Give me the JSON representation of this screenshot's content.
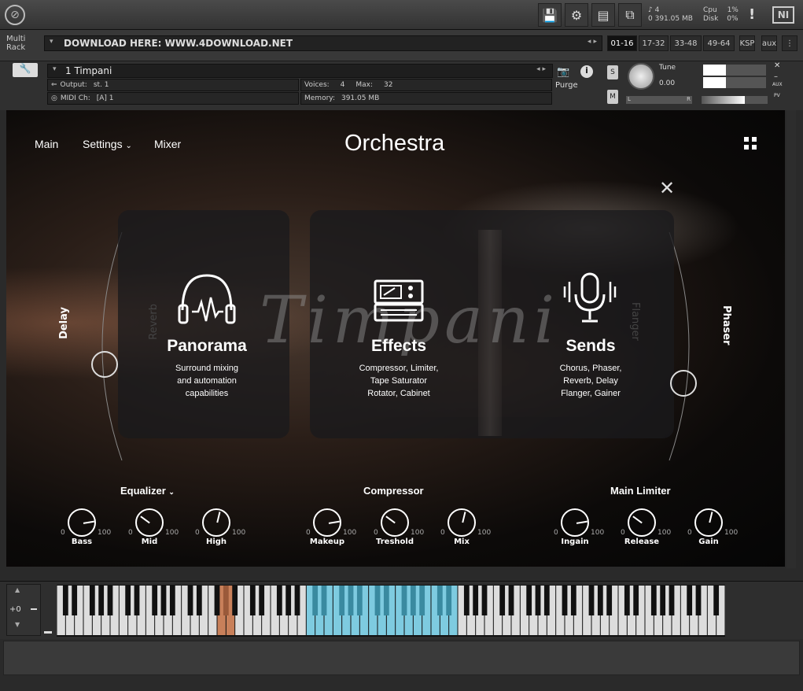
{
  "topbar": {
    "stat_voices": "4",
    "stat_memory": "391.05 MB",
    "cpu_label": "Cpu",
    "cpu_value": "1%",
    "disk_label": "Disk",
    "disk_value": "0%",
    "alert": "!",
    "ni_logo": "NI",
    "mem_prefix": "0"
  },
  "rack": {
    "multi_rack": "Multi Rack",
    "download_text": "DOWNLOAD HERE: WWW.4DOWNLOAD.NET",
    "pages": [
      "01-16",
      "17-32",
      "33-48",
      "49-64"
    ],
    "ksp": "KSP",
    "aux": "aux"
  },
  "instrument": {
    "name": "1 Timpani",
    "output_label": "Output:",
    "output_value": "st. 1",
    "voices_label": "Voices:",
    "voices_value": "4",
    "max_label": "Max:",
    "max_value": "32",
    "midi_label": "MIDI Ch:",
    "midi_value": "[A] 1",
    "memory_label": "Memory:",
    "memory_value": "391.05 MB",
    "purge": "Purge",
    "tune_label": "Tune",
    "tune_value": "0.00",
    "solo": "S",
    "mute": "M",
    "pan_l": "L",
    "pan_r": "R",
    "aux_side": "AUX",
    "pv_side": "PV"
  },
  "main": {
    "nav": [
      "Main",
      "Settings",
      "Mixer"
    ],
    "title": "Orchestra",
    "watermark": "Timpani",
    "left_label": "Delay",
    "left_dim": "Reverb",
    "right_label": "Phaser",
    "right_dim": "Flanger",
    "cards": [
      {
        "title": "Panorama",
        "desc": [
          "Surround mixing",
          "and automation",
          "capabilities"
        ]
      },
      {
        "title": "Effects",
        "desc": [
          "Compressor, Limiter,",
          "Tape Saturator",
          "Rotator, Cabinet"
        ]
      },
      {
        "title": "Sends",
        "desc": [
          "Chorus, Phaser,",
          "Reverb, Delay",
          "Flanger, Gainer"
        ]
      }
    ],
    "sections": [
      "Equalizer",
      "Compressor",
      "Main Limiter"
    ],
    "knobs": [
      {
        "label": "Bass",
        "min": "0",
        "max": "100",
        "value": 80
      },
      {
        "label": "Mid",
        "min": "0",
        "max": "100",
        "value": 30
      },
      {
        "label": "High",
        "min": "0",
        "max": "100",
        "value": 55
      },
      {
        "label": "Makeup",
        "min": "0",
        "max": "100",
        "value": 80
      },
      {
        "label": "Treshold",
        "min": "0",
        "max": "100",
        "value": 30
      },
      {
        "label": "Mix",
        "min": "0",
        "max": "100",
        "value": 55
      },
      {
        "label": "Ingain",
        "min": "0",
        "max": "100",
        "value": 80
      },
      {
        "label": "Release",
        "min": "0",
        "max": "100",
        "value": 30
      },
      {
        "label": "Gain",
        "min": "0",
        "max": "100",
        "value": 55
      }
    ]
  },
  "keyboard": {
    "octave": "+0",
    "highlight_red": "#c8805a",
    "highlight_blue": "#7ecbe0"
  }
}
